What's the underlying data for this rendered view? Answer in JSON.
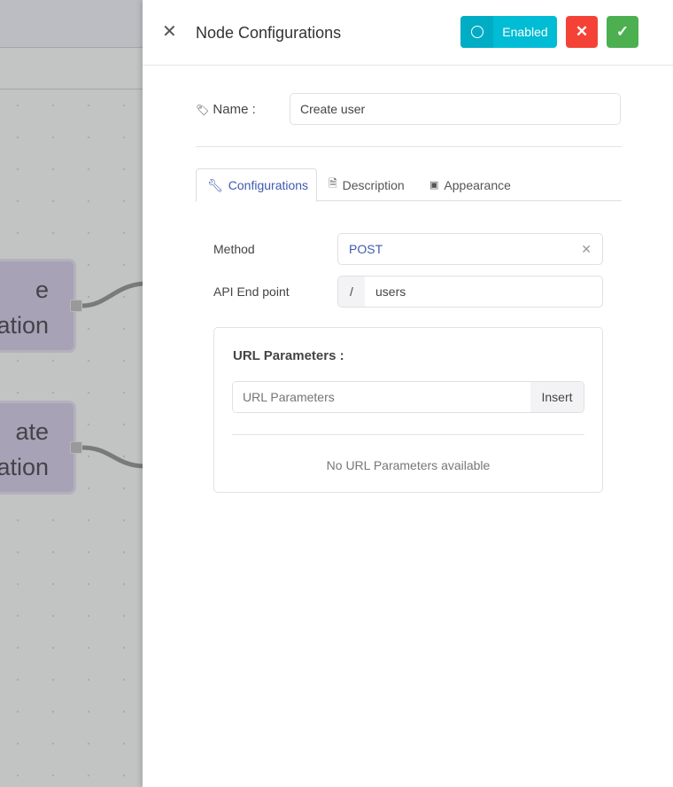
{
  "canvas": {
    "nodes": [
      {
        "line1": "e",
        "line2": "ation"
      },
      {
        "line1": "ate",
        "line2": "ation"
      }
    ]
  },
  "panel": {
    "title": "Node Configurations",
    "toggle_label": "Enabled",
    "name_label": "Name :",
    "name_value": "Create user",
    "tabs": [
      {
        "label": "Configurations",
        "icon": "wrench-icon"
      },
      {
        "label": "Description",
        "icon": "document-icon"
      },
      {
        "label": "Appearance",
        "icon": "palette-icon"
      }
    ],
    "method_label": "Method",
    "method_value": "POST",
    "endpoint_label": "API End point",
    "endpoint_prefix": "/",
    "endpoint_value": "users",
    "url_params": {
      "title": "URL Parameters :",
      "placeholder": "URL Parameters",
      "insert_label": "Insert",
      "empty_text": "No URL Parameters available"
    }
  },
  "colors": {
    "enabled": "#00bcd4",
    "cancel": "#f44336",
    "confirm": "#4caf50",
    "active_tab": "#3d5ab0"
  }
}
